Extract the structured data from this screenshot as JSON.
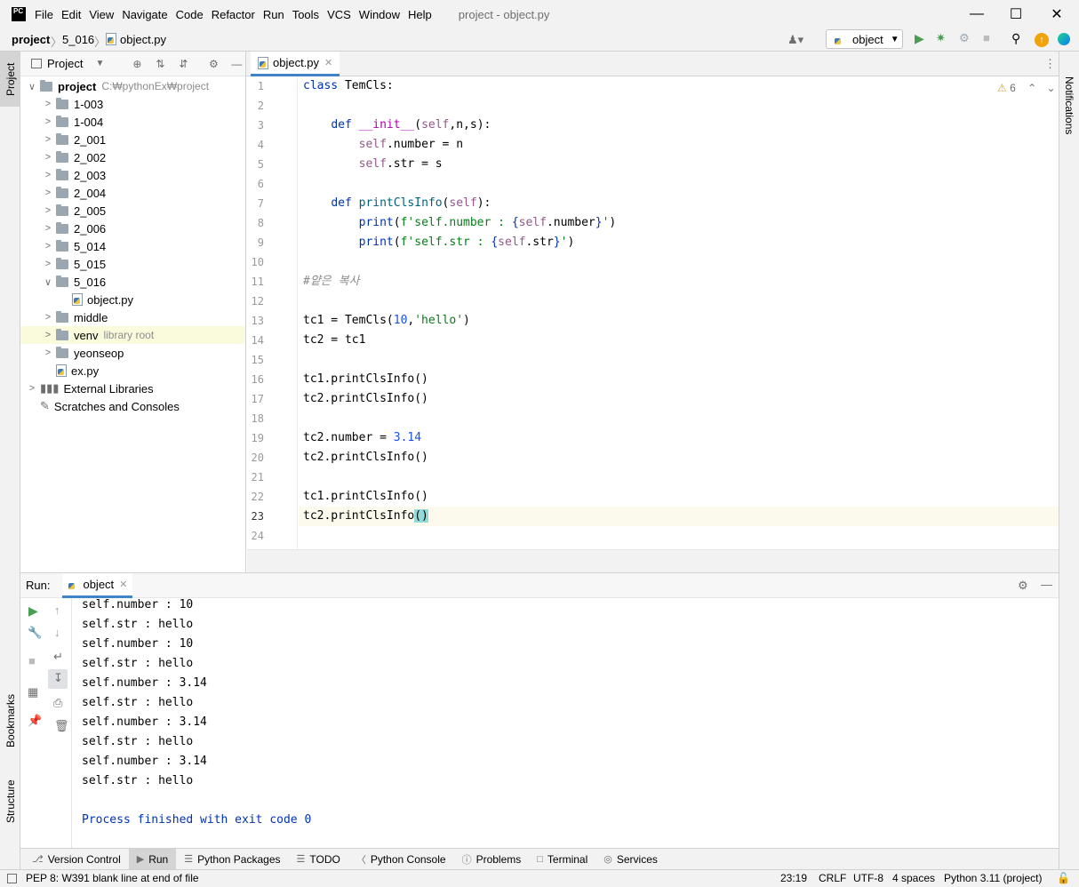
{
  "app": {
    "logo": "PC",
    "title": "project - object.py",
    "menu": [
      "File",
      "Edit",
      "View",
      "Navigate",
      "Code",
      "Refactor",
      "Run",
      "Tools",
      "VCS",
      "Window",
      "Help"
    ]
  },
  "breadcrumb": {
    "project": "project",
    "folder": "5_016",
    "file": "object.py"
  },
  "run_config": "object",
  "left_strip": {
    "project": "Project",
    "bookmarks": "Bookmarks",
    "structure": "Structure"
  },
  "right_strip": {
    "notifications": "Notifications"
  },
  "project_panel": {
    "title": "Project",
    "root": {
      "name": "project",
      "path": "C:₩pythonEx₩project"
    },
    "items": [
      {
        "name": "1-003",
        "type": "folder"
      },
      {
        "name": "1-004",
        "type": "folder"
      },
      {
        "name": "2_001",
        "type": "folder"
      },
      {
        "name": "2_002",
        "type": "folder"
      },
      {
        "name": "2_003",
        "type": "folder"
      },
      {
        "name": "2_004",
        "type": "folder"
      },
      {
        "name": "2_005",
        "type": "folder"
      },
      {
        "name": "2_006",
        "type": "folder"
      },
      {
        "name": "5_014",
        "type": "folder"
      },
      {
        "name": "5_015",
        "type": "folder"
      },
      {
        "name": "5_016",
        "type": "folder"
      },
      {
        "name": "object.py",
        "type": "file"
      },
      {
        "name": "middle",
        "type": "folder"
      },
      {
        "name": "venv",
        "type": "folder",
        "note": "library root"
      },
      {
        "name": "yeonseop",
        "type": "folder"
      },
      {
        "name": "ex.py",
        "type": "file"
      },
      {
        "name": "External Libraries",
        "type": "lib"
      },
      {
        "name": "Scratches and Consoles",
        "type": "scratch"
      }
    ]
  },
  "editor": {
    "tab": "object.py",
    "warnings": "6",
    "line_numbers": [
      "1",
      "2",
      "3",
      "4",
      "5",
      "6",
      "7",
      "8",
      "9",
      "10",
      "11",
      "12",
      "13",
      "14",
      "15",
      "16",
      "17",
      "18",
      "19",
      "20",
      "21",
      "22",
      "23",
      "24"
    ]
  },
  "run": {
    "label": "Run:",
    "tab": "object",
    "output": [
      "self.number : 10",
      "self.str : hello",
      "self.number : 10",
      "self.str : hello",
      "self.number : 3.14",
      "self.str : hello",
      "self.number : 3.14",
      "self.str : hello",
      "self.number : 3.14",
      "self.str : hello",
      "",
      "Process finished with exit code 0"
    ]
  },
  "bottom_tabs": [
    "Version Control",
    "Run",
    "Python Packages",
    "TODO",
    "Python Console",
    "Problems",
    "Terminal",
    "Services"
  ],
  "status": {
    "message": "PEP 8: W391 blank line at end of file",
    "position": "23:19",
    "line_sep": "CRLF",
    "encoding": "UTF-8",
    "indent": "4 spaces",
    "interpreter": "Python 3.11 (project)"
  }
}
